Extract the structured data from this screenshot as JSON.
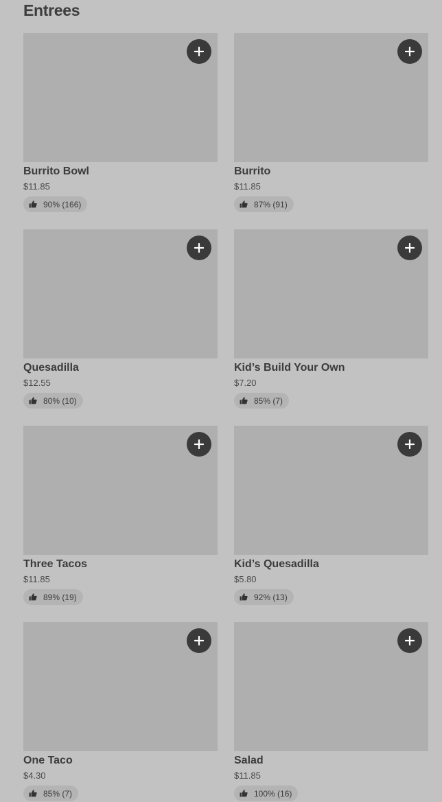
{
  "section": {
    "title": "Entrees"
  },
  "items": [
    {
      "name": "Burrito Bowl",
      "price": "$11.85",
      "rating": "90% (166)"
    },
    {
      "name": "Burrito",
      "price": "$11.85",
      "rating": "87% (91)"
    },
    {
      "name": "Quesadilla",
      "price": "$12.55",
      "rating": "80% (10)"
    },
    {
      "name": "Kid’s Build Your Own",
      "price": "$7.20",
      "rating": "85% (7)"
    },
    {
      "name": "Three Tacos",
      "price": "$11.85",
      "rating": "89% (19)"
    },
    {
      "name": "Kid’s Quesadilla",
      "price": "$5.80",
      "rating": "92% (13)"
    },
    {
      "name": "One Taco",
      "price": "$4.30",
      "rating": "85% (7)"
    },
    {
      "name": "Salad",
      "price": "$11.85",
      "rating": "100% (16)"
    }
  ],
  "icons": {
    "add": "plus-icon",
    "rating": "thumbs-up-icon"
  },
  "colors": {
    "background": "#c2c2c2",
    "placeholder": "#afafaf",
    "button": "#3a3a3a"
  }
}
